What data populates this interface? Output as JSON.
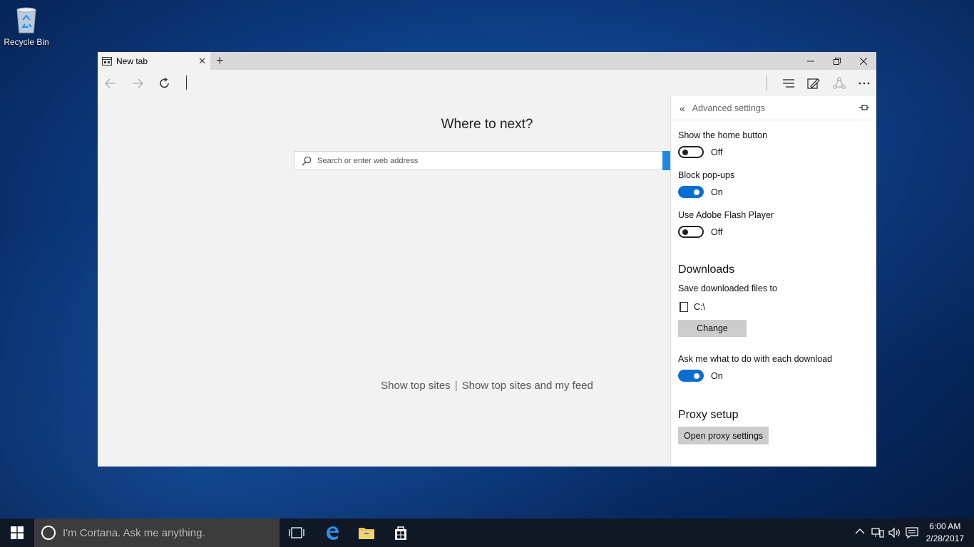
{
  "desktop": {
    "recycle_bin_label": "Recycle Bin"
  },
  "browser": {
    "tab_title": "New tab",
    "new_tab_symbol": "+",
    "close_tab_symbol": "✕",
    "window_controls": {
      "minimize": "—",
      "restore": "❐",
      "close": "✕"
    },
    "new_tab_page": {
      "heading": "Where to next?",
      "search_placeholder": "Search or enter web address",
      "show_top_sites": "Show top sites",
      "separator": "|",
      "show_top_sites_feed": "Show top sites and my feed"
    }
  },
  "settings_panel": {
    "title": "Advanced settings",
    "home_button": {
      "label": "Show the home button",
      "state": "Off"
    },
    "popups": {
      "label": "Block pop-ups",
      "state": "On"
    },
    "flash": {
      "label": "Use Adobe Flash Player",
      "state": "Off"
    },
    "downloads": {
      "heading": "Downloads",
      "save_label": "Save downloaded files to",
      "path": "C:\\",
      "change_button": "Change",
      "ask_label": "Ask me what to do with each download",
      "ask_state": "On"
    },
    "proxy": {
      "heading": "Proxy setup",
      "button": "Open proxy settings"
    }
  },
  "taskbar": {
    "cortana_placeholder": "I'm Cortana. Ask me anything.",
    "time": "6:00 AM",
    "date": "2/28/2017"
  },
  "colors": {
    "accent": "#0a6ed1",
    "taskbar": "#101826",
    "cortana_box": "#3c3c3c"
  }
}
